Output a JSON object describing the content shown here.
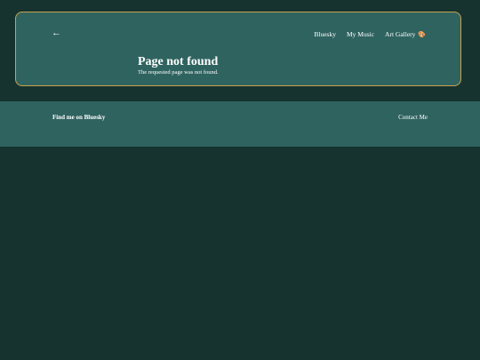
{
  "header": {
    "back_label": "←",
    "nav": [
      {
        "label": "Bluesky"
      },
      {
        "label": "My Music"
      },
      {
        "label": "Art Gallery",
        "icon": "palette-icon",
        "icon_glyph": "🎨"
      }
    ]
  },
  "main": {
    "title": "Page not found",
    "subtitle": "The requested page was not found."
  },
  "footer": {
    "left_link": "Find me on Bluesky",
    "right_link": "Contact Me"
  },
  "colors": {
    "background": "#163330",
    "card": "#2f6360",
    "card_border": "#c7a24e",
    "text": "#ffffff"
  }
}
